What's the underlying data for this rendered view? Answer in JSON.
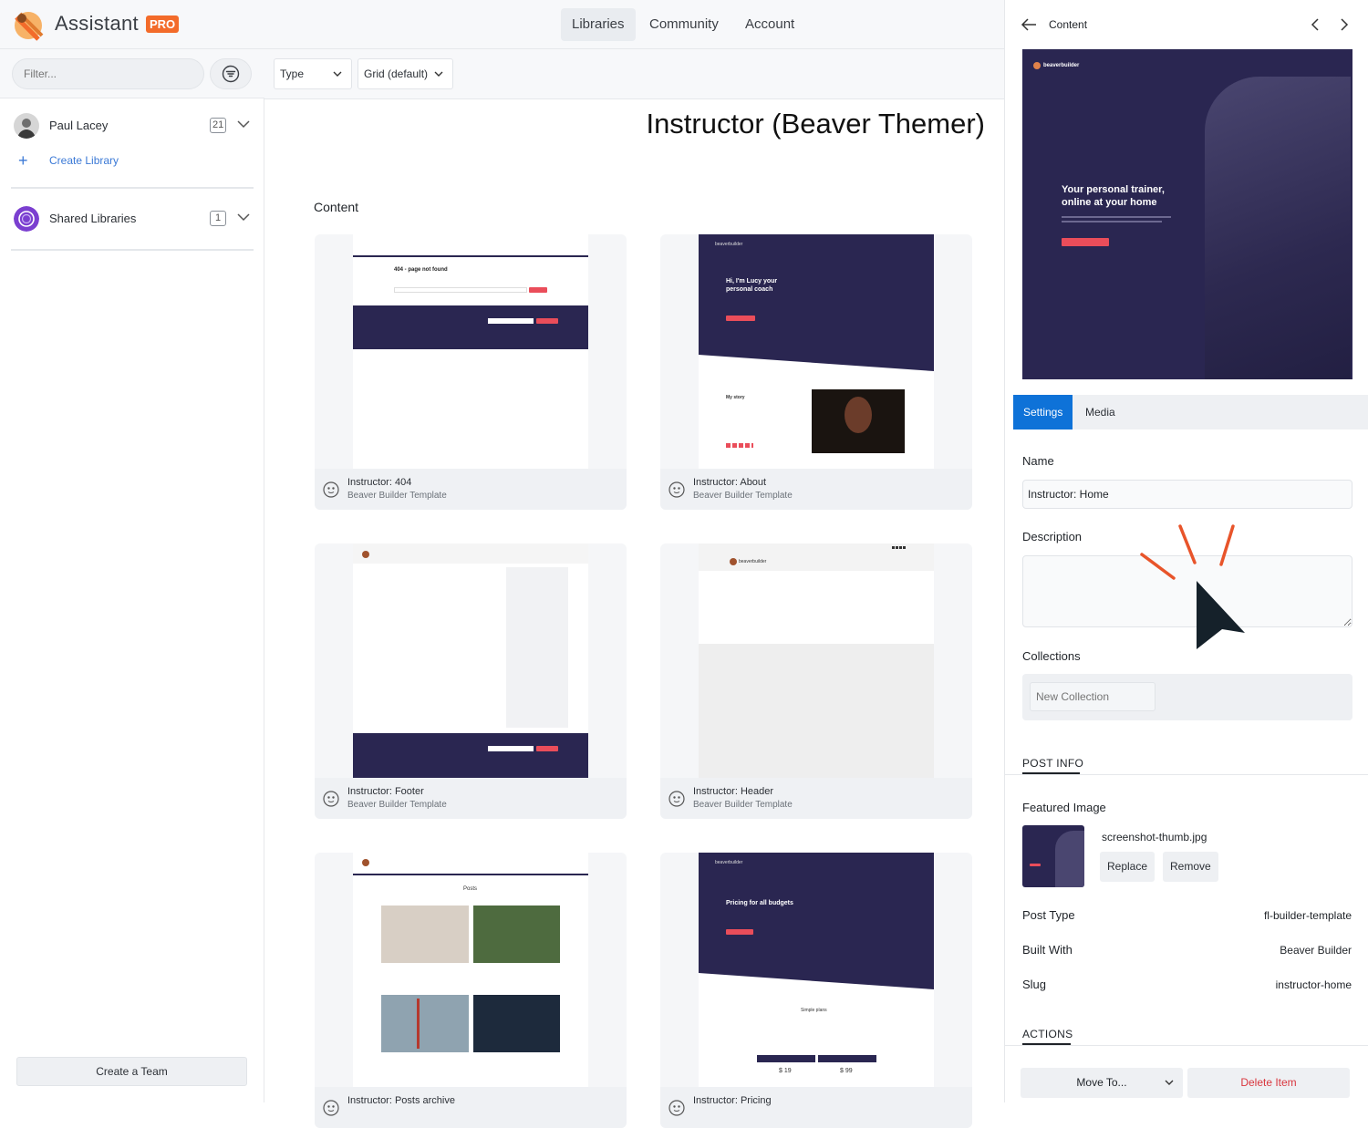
{
  "app": {
    "name": "Assistant",
    "badge": "PRO"
  },
  "nav": {
    "tabs": [
      "Libraries",
      "Community",
      "Account"
    ],
    "active": "Libraries"
  },
  "sidebar": {
    "filter_placeholder": "Filter...",
    "libraries": [
      {
        "name": "Paul Lacey",
        "count": "21"
      },
      {
        "name": "Shared Libraries",
        "count": "1"
      }
    ],
    "create_library": "Create Library",
    "create_team": "Create a Team"
  },
  "toolbar": {
    "type_label": "Type",
    "view_label": "Grid (default)"
  },
  "main": {
    "title": "Instructor (Beaver Themer)",
    "section": "Content",
    "cards": [
      {
        "title": "Instructor: 404",
        "subtitle": "Beaver Builder Template"
      },
      {
        "title": "Instructor: About",
        "subtitle": "Beaver Builder Template"
      },
      {
        "title": "Instructor: Footer",
        "subtitle": "Beaver Builder Template"
      },
      {
        "title": "Instructor: Header",
        "subtitle": "Beaver Builder Template"
      },
      {
        "title": "Instructor: Posts archive",
        "subtitle": ""
      },
      {
        "title": "Instructor: Pricing",
        "subtitle": ""
      }
    ],
    "thumb_text": {
      "notfound_title": "404 - page not found",
      "about_heading_a": "Hi, I'm Lucy your",
      "about_heading_b": "personal coach",
      "about_story": "My story",
      "posts_title": "Posts",
      "pricing_heading": "Pricing for all budgets",
      "simple_plans": "Simple plans",
      "price_a": "$ 19",
      "price_b": "$ 99",
      "brand": "beaverbuilder"
    }
  },
  "panel": {
    "header_title": "Content",
    "preview_heading_a": "Your personal trainer,",
    "preview_heading_b": "online at your home",
    "tabs": [
      "Settings",
      "Media"
    ],
    "name_label": "Name",
    "name_value": "Instructor: Home",
    "description_label": "Description",
    "collections_label": "Collections",
    "collection_placeholder": "New Collection",
    "post_info_heading": "POST INFO",
    "featured_image_label": "Featured Image",
    "featured_image_file": "screenshot-thumb.jpg",
    "replace_label": "Replace",
    "remove_label": "Remove",
    "post_type_label": "Post Type",
    "post_type_value": "fl-builder-template",
    "built_with_label": "Built With",
    "built_with_value": "Beaver Builder",
    "slug_label": "Slug",
    "slug_value": "instructor-home",
    "actions_heading": "ACTIONS",
    "move_to_label": "Move To...",
    "delete_label": "Delete Item"
  },
  "colors": {
    "accent": "#0e72d8",
    "brand": "#f36b2a",
    "dark_theme": "#2a2651",
    "danger": "#d9363e",
    "link": "#3b79d6"
  }
}
